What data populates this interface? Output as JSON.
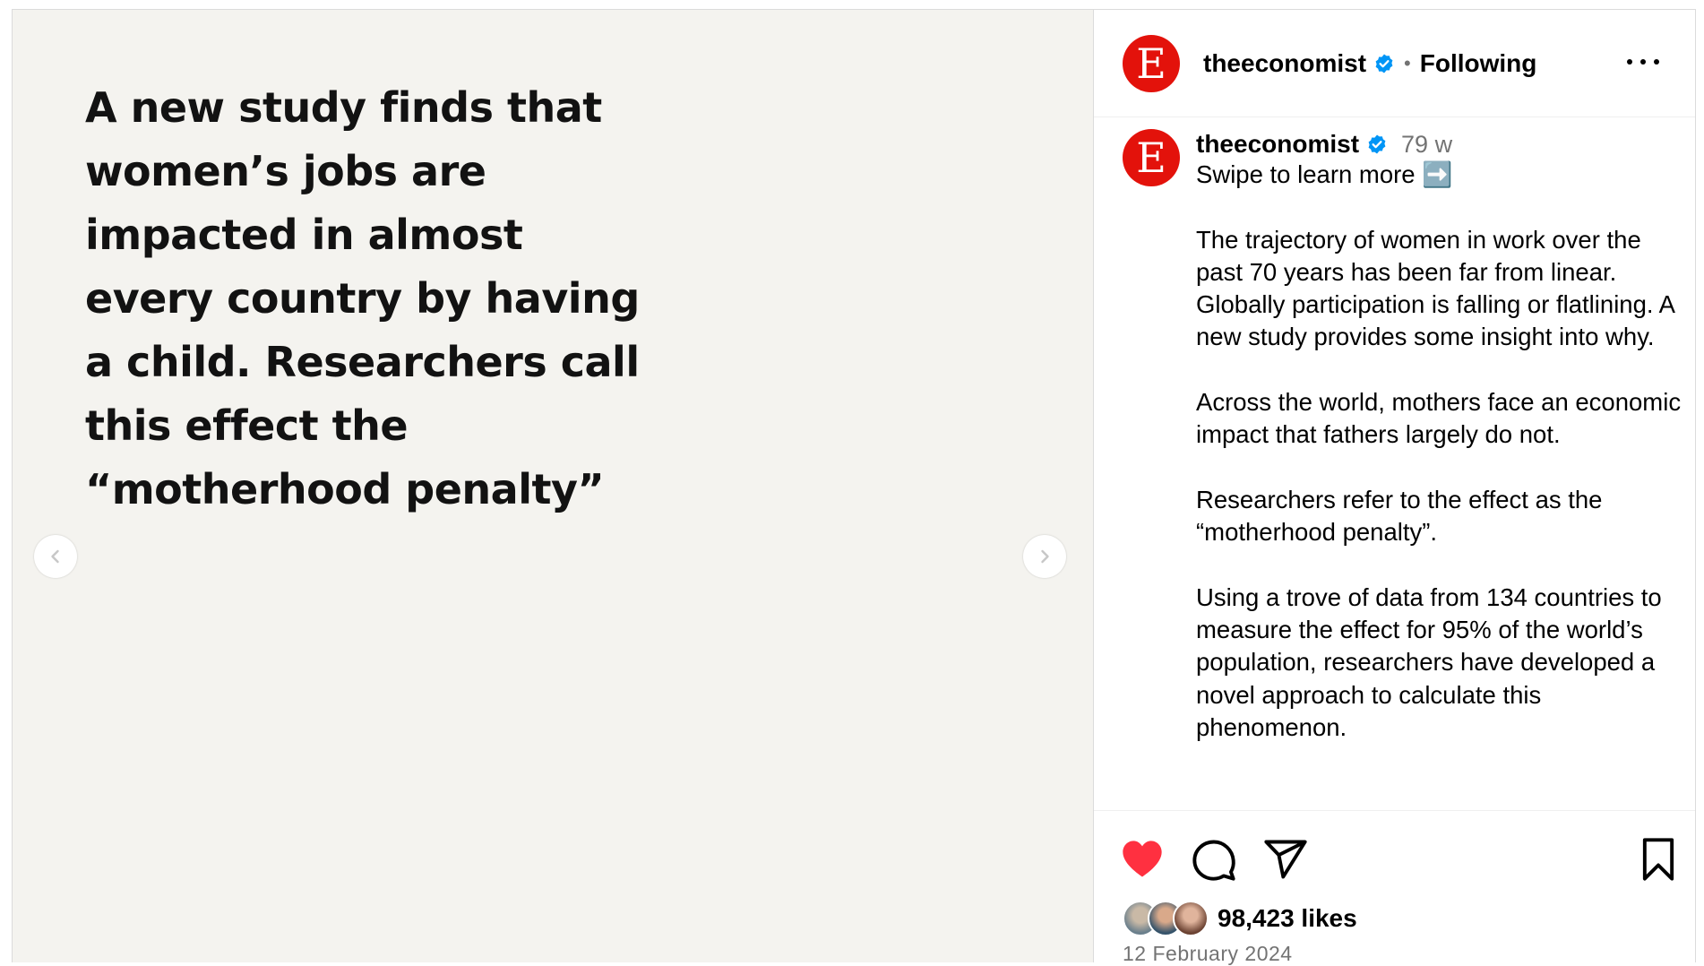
{
  "slide": {
    "text": "A new study finds that women’s jobs are impacted in almost every country by having a child. Researchers call this effect the “motherhood penalty”",
    "prev_icon": "chevron-left-icon",
    "next_icon": "chevron-right-icon"
  },
  "header": {
    "avatar_letter": "E",
    "username": "theeconomist",
    "verified_icon": "verified-badge-icon",
    "separator": "•",
    "following_label": "Following",
    "more_icon": "more-options-icon"
  },
  "caption": {
    "avatar_letter": "E",
    "username": "theeconomist",
    "time_ago": "79 w",
    "text": "Swipe to learn more ➡️\n\nThe trajectory of women in work over the past 70 years has been far from linear. Globally participation is falling or flatlining. A new study provides some insight into why.\n\nAcross the world, mothers face an economic impact that fathers largely do not.\n\nResearchers refer to the effect as the “motherhood penalty”.\n\nUsing a trove of data from 134 countries to measure the effect for 95% of the world’s population, researchers have developed a novel approach to calculate this phenomenon."
  },
  "actions": {
    "like_icon": "heart-filled-icon",
    "comment_icon": "comment-icon",
    "share_icon": "send-icon",
    "save_icon": "bookmark-icon",
    "liked": true
  },
  "likes": {
    "count_text": "98,423 likes"
  },
  "date": "12 February 2024",
  "colors": {
    "brand_red": "#e3120b",
    "like_red": "#ff3040",
    "verified_blue": "#0095f6",
    "media_background": "#f4f3ef",
    "secondary_text": "#737373"
  }
}
